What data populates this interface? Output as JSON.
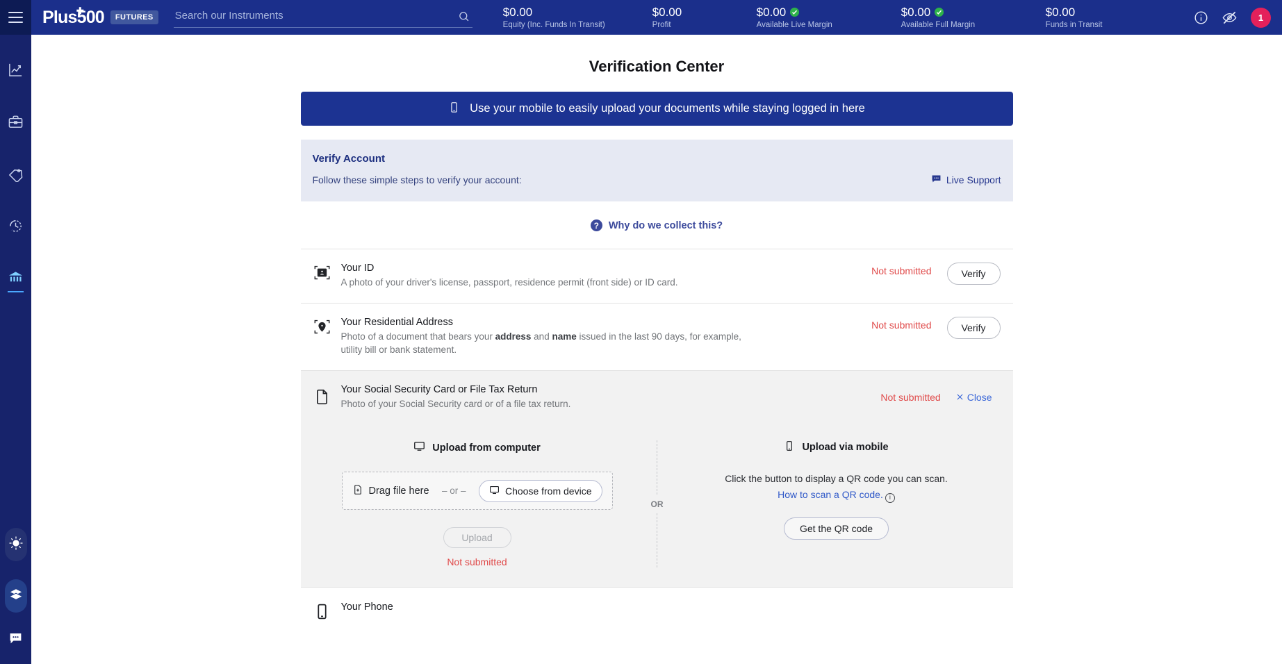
{
  "topbar": {
    "menu_icon": "hamburger-icon",
    "brand": "Plus500",
    "brand_badge": "FUTURES",
    "search_placeholder": "Search our Instruments",
    "search_value": "",
    "stats": [
      {
        "value": "$0.00",
        "label": "Equity (Inc. Funds In Transit)",
        "verified": false
      },
      {
        "value": "$0.00",
        "label": "Profit",
        "verified": false
      },
      {
        "value": "$0.00",
        "label": "Available Live Margin",
        "verified": true
      },
      {
        "value": "$0.00",
        "label": "Available Full Margin",
        "verified": true
      },
      {
        "value": "$0.00",
        "label": "Funds in Transit",
        "verified": false
      }
    ],
    "info_icon": "info-icon",
    "hide_icon": "eye-off-icon",
    "avatar_badge": "1",
    "accent_green": "#2eb34a",
    "avatar_color": "#e4215b",
    "bar_color": "#1b2f8b"
  },
  "sidebar": {
    "items": [
      {
        "name": "trade",
        "icon": "chart-line-icon",
        "active": false
      },
      {
        "name": "portfolio",
        "icon": "briefcase-icon",
        "active": false
      },
      {
        "name": "orders",
        "icon": "tag-icon",
        "active": false
      },
      {
        "name": "history",
        "icon": "clock-history-icon",
        "active": false
      },
      {
        "name": "funds",
        "icon": "bank-icon",
        "active": true
      }
    ],
    "bottom": [
      {
        "name": "theme-toggle",
        "icon": "sun-icon"
      },
      {
        "name": "layers",
        "icon": "layers-icon"
      },
      {
        "name": "chat",
        "icon": "chat-bubble-icon"
      }
    ]
  },
  "page": {
    "title": "Verification Center",
    "mobile_banner": {
      "icon": "mobile-phone-icon",
      "text": "Use your mobile to easily upload your documents while staying logged in here"
    },
    "verify_card": {
      "title": "Verify Account",
      "subtitle": "Follow these simple steps to verify your account:",
      "support_label": "Live Support",
      "support_icon": "chat-icon"
    },
    "why_row": {
      "badge": "?",
      "text": "Why do we collect this?"
    },
    "documents": [
      {
        "icon": "id-card-scan-icon",
        "name": "Your ID",
        "description": "A photo of your driver's license, passport, residence permit (front side) or ID card.",
        "status": "Not submitted",
        "action": "Verify"
      },
      {
        "icon": "location-pin-scan-icon",
        "name": "Your Residential Address",
        "description_parts": [
          {
            "text": "Photo of a document that bears your ",
            "bold": false
          },
          {
            "text": "address",
            "bold": true
          },
          {
            "text": " and ",
            "bold": false
          },
          {
            "text": "name",
            "bold": true
          },
          {
            "text": " issued in the last 90 days, for example, utility bill or bank statement.",
            "bold": false
          }
        ],
        "status": "Not submitted",
        "action": "Verify"
      },
      {
        "icon": "document-icon",
        "name": "Your Social Security Card or File Tax Return",
        "description": "Photo of your Social Security card or of a file tax return.",
        "status": "Not submitted",
        "action": "Close",
        "expanded": true
      }
    ],
    "upload_panel": {
      "computer": {
        "icon": "monitor-icon",
        "heading": "Upload from computer",
        "drag_icon": "file-add-icon",
        "drag_label": "Drag file here",
        "or_label": "– or –",
        "choose_icon": "monitor-icon",
        "choose_label": "Choose from device",
        "upload_label": "Upload",
        "status": "Not submitted"
      },
      "divider_label": "OR",
      "mobile": {
        "icon": "mobile-phone-icon",
        "heading": "Upload via mobile",
        "note": "Click the button to display a QR code you can scan.",
        "link": "How to scan a QR code.",
        "link_info_icon": "info-icon",
        "qr_button": "Get the QR code"
      }
    },
    "next_row": {
      "icon": "phone-icon",
      "name": "Your Phone"
    },
    "status_color": "#e04a4a",
    "link_color": "#2f58c8"
  }
}
